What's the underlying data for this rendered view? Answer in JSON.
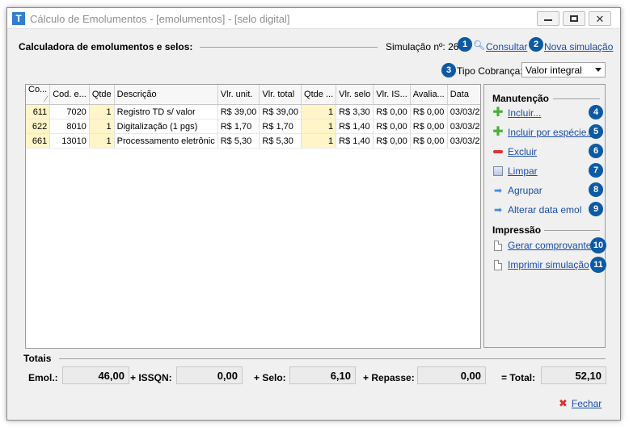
{
  "window": {
    "title": "Cálculo de Emolumentos - [emolumentos] - [selo digital]",
    "app_icon_letter": "T"
  },
  "header": {
    "section_title": "Calculadora de emolumentos e selos:",
    "simulation_label": "Simulação nº: 26",
    "consultar_label": "Consultar",
    "nova_simulacao_label": "Nova simulação",
    "tipo_cobranca_label": "Tipo Cobrança:",
    "tipo_cobranca_value": "Valor integral"
  },
  "badges": [
    "1",
    "2",
    "3",
    "4",
    "5",
    "6",
    "7",
    "8",
    "9",
    "10",
    "11"
  ],
  "table": {
    "columns": [
      "Co...",
      "Cod. e...",
      "Qtde",
      "Descrição",
      "Vlr. unit.",
      "Vlr. total",
      "Qtde ...",
      "Vlr. selo",
      "Vlr. IS...",
      "Avalia...",
      "Data"
    ],
    "rows": [
      [
        "611",
        "7020",
        "1",
        "Registro TD s/ valor",
        "R$ 39,00",
        "R$ 39,00",
        "1",
        "R$ 3,30",
        "R$ 0,00",
        "R$ 0,00",
        "03/03/2"
      ],
      [
        "622",
        "8010",
        "1",
        "Digitalização (1 pgs)",
        "R$ 1,70",
        "R$ 1,70",
        "1",
        "R$ 1,40",
        "R$ 0,00",
        "R$ 0,00",
        "03/03/2"
      ],
      [
        "661",
        "13010",
        "1",
        "Processamento eletrônic",
        "R$ 5,30",
        "R$ 5,30",
        "1",
        "R$ 1,40",
        "R$ 0,00",
        "R$ 0,00",
        "03/03/2"
      ]
    ]
  },
  "side": {
    "manutencao_title": "Manutenção",
    "impressao_title": "Impressão",
    "actions": [
      "Incluir...",
      "Incluir por espécie...",
      "Excluir",
      "Limpar",
      "Agrupar",
      "Alterar data emol"
    ],
    "print_actions": [
      "Gerar comprovante",
      "Imprimir simulação"
    ]
  },
  "totals": {
    "title": "Totais",
    "emol_label": "Emol.:",
    "emol_value": "46,00",
    "issqn_label": "+ ISSQN:",
    "issqn_value": "0,00",
    "selo_label": "+ Selo:",
    "selo_value": "6,10",
    "repasse_label": "+ Repasse:",
    "repasse_value": "0,00",
    "total_label": "= Total:",
    "total_value": "52,10"
  },
  "footer": {
    "fechar_label": "Fechar"
  },
  "colors": {
    "badge": "#0d5aa4",
    "link": "#1a4ea8",
    "row_highlight": "#fff5c8"
  }
}
